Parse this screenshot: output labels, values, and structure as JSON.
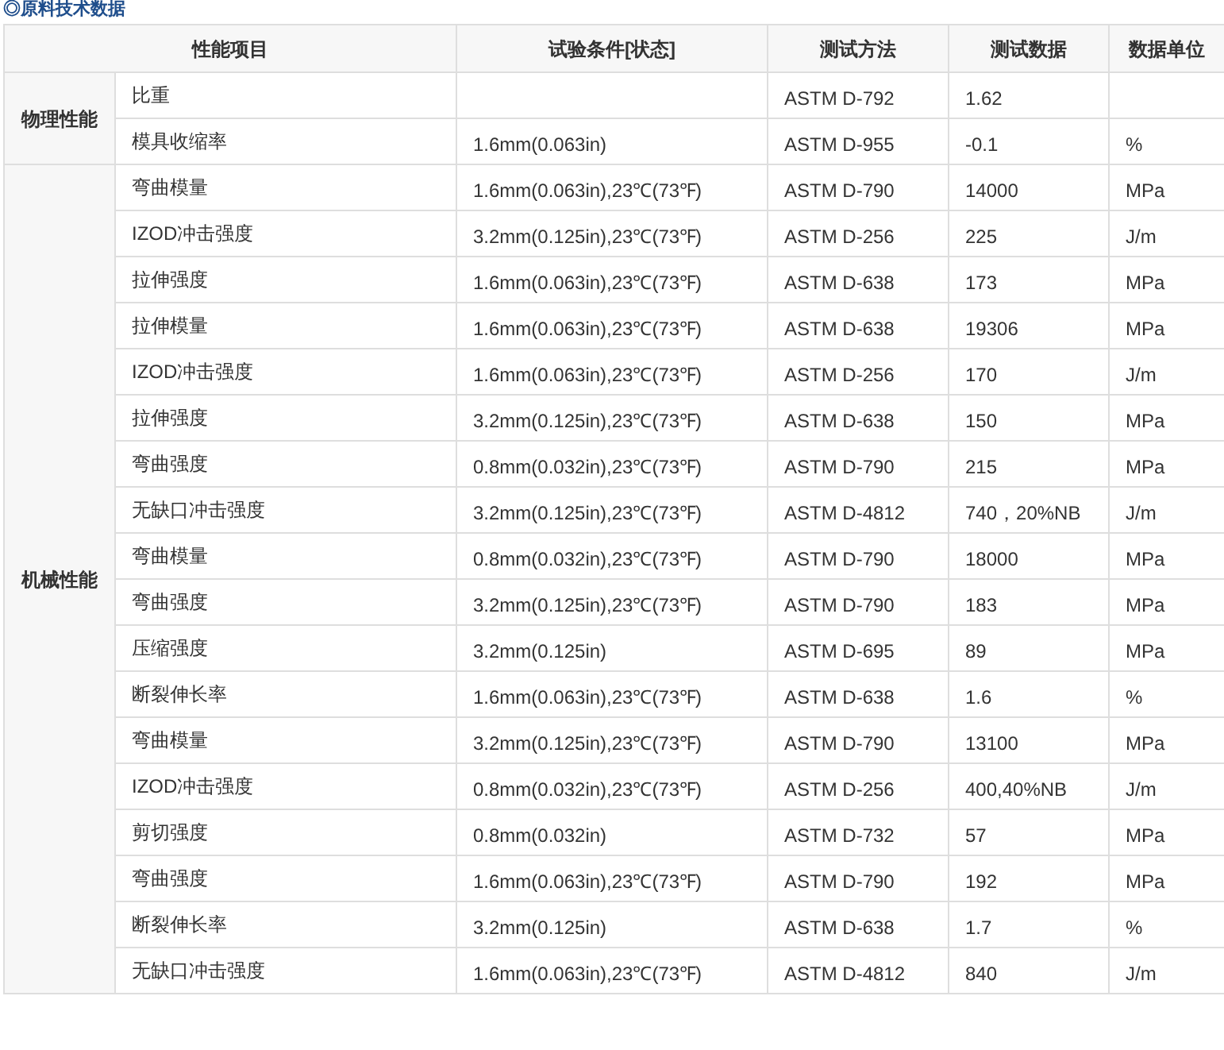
{
  "title": "◎原料技术数据",
  "table": {
    "columns": [
      "性能项目",
      "试验条件[状态]",
      "测试方法",
      "测试数据",
      "数据单位"
    ],
    "groups": [
      {
        "name": "物理性能",
        "rows": [
          {
            "item": "比重",
            "condition": "",
            "method": "ASTM D-792",
            "value": "1.62",
            "unit": ""
          },
          {
            "item": "模具收缩率",
            "condition": "1.6mm(0.063in)",
            "method": "ASTM D-955",
            "value": "-0.1",
            "unit": "%"
          }
        ]
      },
      {
        "name": "机械性能",
        "rows": [
          {
            "item": "弯曲模量",
            "condition": "1.6mm(0.063in),23℃(73℉)",
            "method": "ASTM D-790",
            "value": "14000",
            "unit": "MPa"
          },
          {
            "item": "IZOD冲击强度",
            "condition": "3.2mm(0.125in),23℃(73℉)",
            "method": "ASTM D-256",
            "value": "225",
            "unit": "J/m"
          },
          {
            "item": "拉伸强度",
            "condition": "1.6mm(0.063in),23℃(73℉)",
            "method": "ASTM D-638",
            "value": "173",
            "unit": "MPa"
          },
          {
            "item": "拉伸模量",
            "condition": "1.6mm(0.063in),23℃(73℉)",
            "method": "ASTM D-638",
            "value": "19306",
            "unit": "MPa"
          },
          {
            "item": "IZOD冲击强度",
            "condition": "1.6mm(0.063in),23℃(73℉)",
            "method": "ASTM D-256",
            "value": "170",
            "unit": "J/m"
          },
          {
            "item": "拉伸强度",
            "condition": "3.2mm(0.125in),23℃(73℉)",
            "method": "ASTM D-638",
            "value": "150",
            "unit": "MPa"
          },
          {
            "item": "弯曲强度",
            "condition": "0.8mm(0.032in),23℃(73℉)",
            "method": "ASTM D-790",
            "value": "215",
            "unit": "MPa"
          },
          {
            "item": "无缺口冲击强度",
            "condition": "3.2mm(0.125in),23℃(73℉)",
            "method": "ASTM D-4812",
            "value": "740，20%NB",
            "unit": "J/m"
          },
          {
            "item": "弯曲模量",
            "condition": "0.8mm(0.032in),23℃(73℉)",
            "method": "ASTM D-790",
            "value": "18000",
            "unit": "MPa"
          },
          {
            "item": "弯曲强度",
            "condition": "3.2mm(0.125in),23℃(73℉)",
            "method": "ASTM D-790",
            "value": "183",
            "unit": "MPa"
          },
          {
            "item": "压缩强度",
            "condition": "3.2mm(0.125in)",
            "method": "ASTM D-695",
            "value": "89",
            "unit": "MPa"
          },
          {
            "item": "断裂伸长率",
            "condition": "1.6mm(0.063in),23℃(73℉)",
            "method": "ASTM D-638",
            "value": "1.6",
            "unit": "%"
          },
          {
            "item": "弯曲模量",
            "condition": "3.2mm(0.125in),23℃(73℉)",
            "method": "ASTM D-790",
            "value": "13100",
            "unit": "MPa"
          },
          {
            "item": "IZOD冲击强度",
            "condition": "0.8mm(0.032in),23℃(73℉)",
            "method": "ASTM D-256",
            "value": "400,40%NB",
            "unit": "J/m"
          },
          {
            "item": "剪切强度",
            "condition": "0.8mm(0.032in)",
            "method": "ASTM D-732",
            "value": "57",
            "unit": "MPa"
          },
          {
            "item": "弯曲强度",
            "condition": "1.6mm(0.063in),23℃(73℉)",
            "method": "ASTM D-790",
            "value": "192",
            "unit": "MPa"
          },
          {
            "item": "断裂伸长率",
            "condition": "3.2mm(0.125in)",
            "method": "ASTM D-638",
            "value": "1.7",
            "unit": "%"
          },
          {
            "item": "无缺口冲击强度",
            "condition": "1.6mm(0.063in),23℃(73℉)",
            "method": "ASTM D-4812",
            "value": "840",
            "unit": "J/m"
          }
        ]
      }
    ]
  }
}
